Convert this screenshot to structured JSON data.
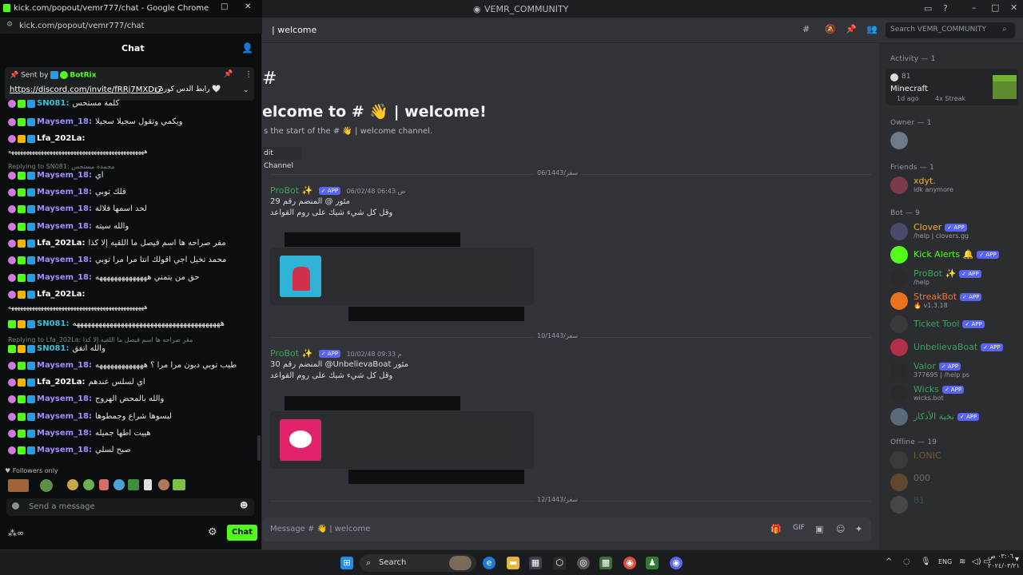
{
  "discord": {
    "window_title": "VEMR_COMMUNITY",
    "channel_name": "welcome",
    "search_placeholder": "Search VEMR_COMMUNITY",
    "welcome_heading": "elcome to # 👋 | welcome!",
    "welcome_sub": "s the start of the # 👋 | welcome channel.",
    "edit_channel": "dit Channel",
    "message_placeholder": "Message # 👋 | welcome",
    "dates": [
      "06/1443/سفر",
      "10/1443/سفر",
      "12/1443/سفر"
    ],
    "messages": [
      {
        "author": "ProBot ✨",
        "badge": "✓ APP",
        "time": "06/02/48 06:43 ص",
        "line1": "29 المنضم رقم @‎ مئور",
        "line2": "وقل كل شيء شيك على روم القواعد"
      },
      {
        "author": "ProBot ✨",
        "badge": "✓ APP",
        "time": "10/02/48 09:33 م",
        "line1": "30 المنضم رقم @UnbelievaBoat مئور",
        "line2": "وقل كل شيء شيك على روم القواعد"
      }
    ],
    "members": {
      "activity_header": "Activity — 1",
      "activity": {
        "count": "81",
        "game": "Minecraft",
        "detail1": "1d ago",
        "detail2": "4x Streak"
      },
      "owner_header": "Owner — 1",
      "friends_header": "Friends — 1",
      "friend": {
        "name": "xdyt.",
        "status": "idk anymore"
      },
      "bot_header": "Bot — 9",
      "bots": [
        {
          "name": "Clover",
          "sub": "/help | clovers.gg",
          "color": "#f0b232"
        },
        {
          "name": "Kick Alerts 🔔",
          "sub": "",
          "color": "#53fc18"
        },
        {
          "name": "ProBot ✨",
          "sub": "/help",
          "color": "#3ba55c"
        },
        {
          "name": "StreakBot",
          "sub": "🔥 v1.3.18",
          "color": "#f57731"
        },
        {
          "name": "Ticket Tool",
          "sub": "",
          "color": "#3ba55c"
        },
        {
          "name": "UnbelievaBoat",
          "sub": "",
          "color": "#3ba55c"
        },
        {
          "name": "Valor",
          "sub": "377695 | /help ps",
          "color": "#3ba55c"
        },
        {
          "name": "Wicks",
          "sub": "wicks.bot",
          "color": "#3ba55c"
        },
        {
          "name": "نخبة الأذكار",
          "sub": "",
          "color": "#3ba55c"
        }
      ],
      "offline_header": "Offline — 19",
      "offline": [
        "I.ONIC",
        "000",
        "81"
      ]
    }
  },
  "kick": {
    "window_title": "kick.com/popout/vemr777/chat - Google Chrome",
    "url": "kick.com/popout/vemr777/chat",
    "header": "Chat",
    "pinned_sender_label": "Sent by",
    "pinned_sender": "BotRix",
    "pinned_link": "https://discord.com/invite/fRRj7MXDr7",
    "pinned_suffix": "رابط الدس كوردن 🤍",
    "lines": [
      {
        "user": "SN081:",
        "text": "كلمة مستحس",
        "color": "#30c4e0"
      },
      {
        "user": "Maysem_18:",
        "text": "ويكمي وتقول سجيلا سجيلا",
        "color": "#a68bff"
      },
      {
        "user": "Lfa_202La:",
        "text": "",
        "color": "#ffffff"
      },
      {
        "user": "Maysem_18:",
        "text": "اي",
        "color": "#a68bff"
      },
      {
        "user": "Maysem_18:",
        "text": "قلك توبي",
        "color": "#a68bff"
      },
      {
        "user": "Maysem_18:",
        "text": "لحد اسمها فلالة",
        "color": "#a68bff"
      },
      {
        "user": "Maysem_18:",
        "text": "والله سيته",
        "color": "#a68bff"
      },
      {
        "user": "Lfa_202La:",
        "text": "مقر صراحه ها اسم فيصل ما اللقيه إلا كذا",
        "color": "#ffffff"
      },
      {
        "user": "Maysem_18:",
        "text": "محمد تخيل اجي اقولك انتا مرا مرا توبي",
        "color": "#a68bff"
      },
      {
        "user": "Maysem_18:",
        "text": "حق من يتمني ههههههههههههههه",
        "color": "#a68bff"
      },
      {
        "user": "Lfa_202La:",
        "text": "",
        "color": "#ffffff"
      },
      {
        "user": "SN081:",
        "text": "ههههههههههههههههههههههههههههههههههههههههه",
        "color": "#30c4e0"
      },
      {
        "user": "SN081:",
        "text": "والله اتفق",
        "color": "#30c4e0"
      },
      {
        "user": "Maysem_18:",
        "text": "طيب توبي دبون مرا مرا ؟ هههههههههههههه",
        "color": "#a68bff"
      },
      {
        "user": "Lfa_202La:",
        "text": "اي لسلس عندهم",
        "color": "#ffffff"
      },
      {
        "user": "Maysem_18:",
        "text": "والله بالمحض الهروج",
        "color": "#a68bff"
      },
      {
        "user": "Maysem_18:",
        "text": "لبسوها شراع وجمطوها",
        "color": "#a68bff"
      },
      {
        "user": "Maysem_18:",
        "text": "هييت اطها جميله",
        "color": "#a68bff"
      },
      {
        "user": "Maysem_18:",
        "text": "صبح لسلي",
        "color": "#a68bff"
      }
    ],
    "long_line": "ههههههههههههههههههههههههههههههههههههههههههههههه",
    "replies": [
      "Replying to SN081: مجمدة مستحس",
      "Replying to Lfa_202La: مقر صراحه ها اسم فيصل ما اللقيه إلا كذا"
    ],
    "followers_only": "Followers only",
    "input_placeholder": "Send a message",
    "send_label": "Chat"
  },
  "taskbar": {
    "search": "Search",
    "lang": "ENG",
    "time": "٠٣:٠٦ ص",
    "date": "٢٠٢٤/٠٣/٢١"
  }
}
